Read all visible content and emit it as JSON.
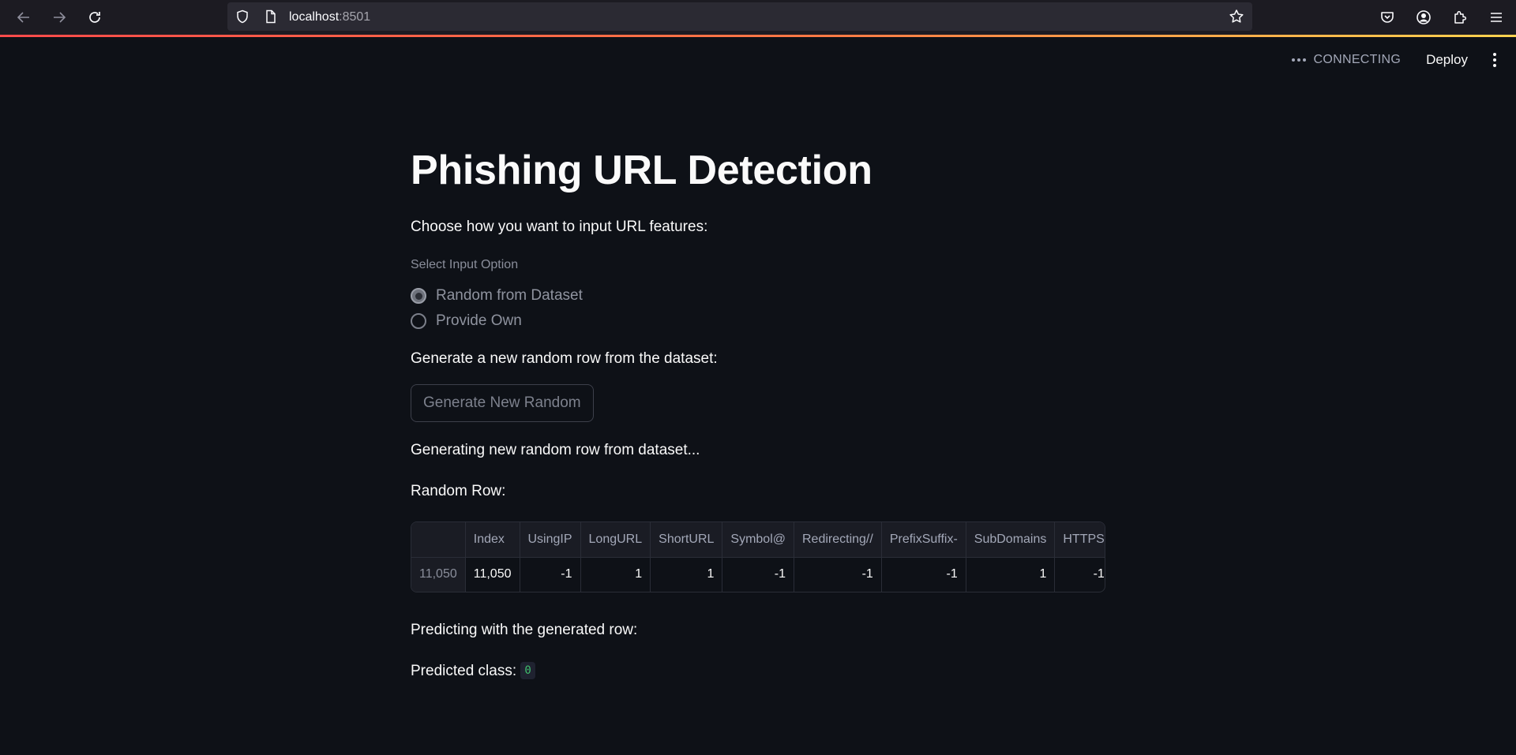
{
  "browser": {
    "url_host": "localhost",
    "url_port": ":8501"
  },
  "app_header": {
    "status": "CONNECTING",
    "deploy_label": "Deploy"
  },
  "main": {
    "title": "Phishing URL Detection",
    "intro": "Choose how you want to input URL features:",
    "radio_group_label": "Select Input Option",
    "radio_options": [
      "Random from Dataset",
      "Provide Own"
    ],
    "selected_option": "Random from Dataset",
    "generate_prompt": "Generate a new random row from the dataset:",
    "generate_button": "Generate New Random",
    "generating_text": "Generating new random row from dataset...",
    "random_row_label": "Random Row:",
    "table": {
      "columns": [
        "",
        "Index",
        "UsingIP",
        "LongURL",
        "ShortURL",
        "Symbol@",
        "Redirecting//",
        "PrefixSuffix-",
        "SubDomains",
        "HTTPS"
      ],
      "rows": [
        [
          "11,050",
          "11,050",
          "-1",
          "1",
          "1",
          "-1",
          "-1",
          "-1",
          "1",
          "-1"
        ]
      ]
    },
    "predicting_text": "Predicting with the generated row:",
    "predicted_label": "Predicted class:",
    "predicted_value": "0"
  }
}
